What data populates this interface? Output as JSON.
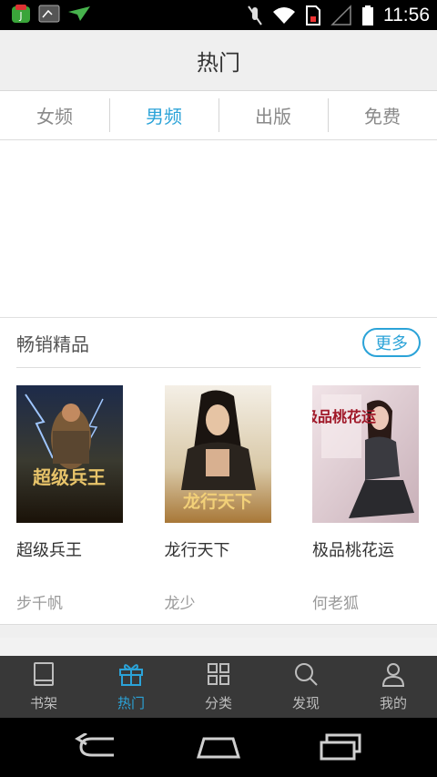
{
  "status_bar": {
    "time": "11:56",
    "icons": [
      "app-icon",
      "screen-icon",
      "paper-plane-icon",
      "mute-icon",
      "wifi-icon",
      "sim-icon",
      "signal-icon",
      "battery-icon"
    ]
  },
  "header": {
    "title": "热门"
  },
  "tabs": [
    {
      "label": "女频",
      "active": false
    },
    {
      "label": "男频",
      "active": true
    },
    {
      "label": "出版",
      "active": false
    },
    {
      "label": "免费",
      "active": false
    }
  ],
  "section": {
    "title": "畅销精品",
    "more_label": "更多",
    "books": [
      {
        "title": "超级兵王",
        "author": "步千帆",
        "cover_text": "超级兵王"
      },
      {
        "title": "龙行天下",
        "author": "龙少",
        "cover_text": "龙行天下"
      },
      {
        "title": "极品桃花运",
        "author": "何老狐",
        "cover_text": "极品桃花运"
      }
    ]
  },
  "bottom_nav": [
    {
      "label": "书架",
      "icon": "book-icon",
      "active": false
    },
    {
      "label": "热门",
      "icon": "gift-icon",
      "active": true
    },
    {
      "label": "分类",
      "icon": "grid-icon",
      "active": false
    },
    {
      "label": "发现",
      "icon": "search-icon",
      "active": false
    },
    {
      "label": "我的",
      "icon": "user-icon",
      "active": false
    }
  ],
  "colors": {
    "accent": "#2ba3d8",
    "tabbar_bg": "#383838"
  }
}
